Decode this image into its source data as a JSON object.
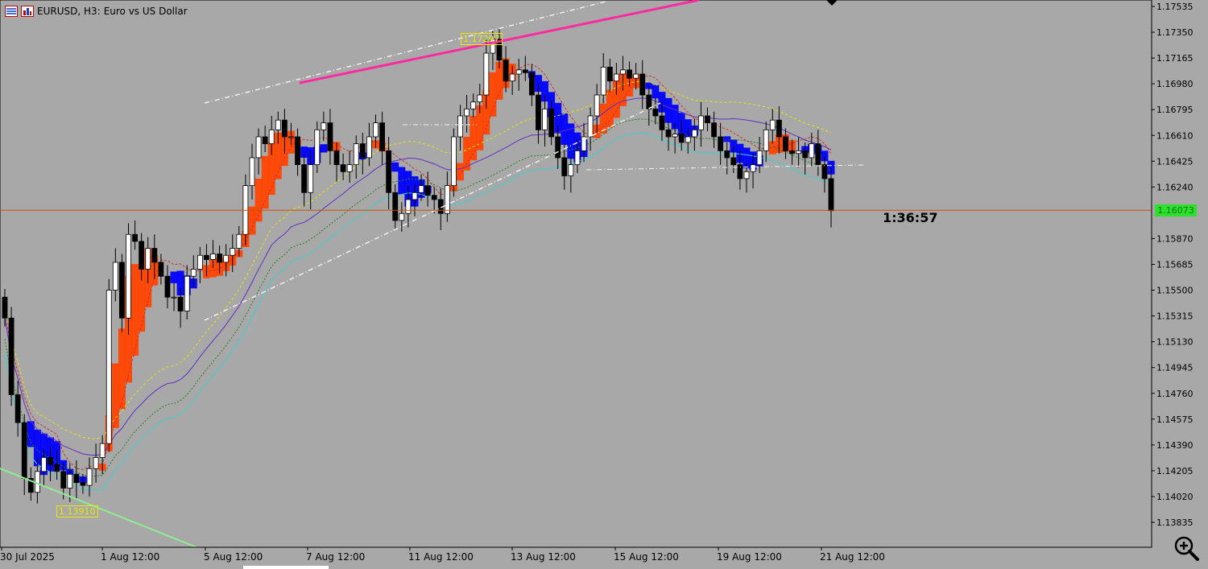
{
  "header": {
    "symbol": "EURUSD, H3:",
    "description": "Euro vs US Dollar"
  },
  "timer": "1:36:57",
  "current_price_label": "1.16073",
  "high_label": "1.17297",
  "low_label": "1.13910",
  "icons": [
    "grid-icon",
    "bar-chart-icon",
    "zoom-in-icon"
  ],
  "colors": {
    "background": "#a8a8a8",
    "bull_candle": "#ffffff",
    "bear_candle": "#000000",
    "cloud_bear": "#ff4500",
    "cloud_bull": "#0000ff",
    "price_line": "#d05000",
    "trend_magenta": "#ff2aa0",
    "trend_green": "#90ee90",
    "yellow": "#e8e800",
    "cyan": "#40d0d0"
  },
  "chart_data": {
    "type": "candlestick",
    "title": "",
    "ylim": [
      1.1374,
      1.1762
    ],
    "y_ticks": [
      1.17535,
      1.1735,
      1.17165,
      1.1698,
      1.16795,
      1.1661,
      1.16425,
      1.1624,
      1.1587,
      1.15685,
      1.155,
      1.15315,
      1.1513,
      1.14945,
      1.1476,
      1.14575,
      1.1439,
      1.14205,
      1.1402,
      1.13835
    ],
    "y_tick_labels": [
      "1.17535",
      "1.17350",
      "1.17165",
      "1.16980",
      "1.16795",
      "1.16610",
      "1.16425",
      "1.16240",
      "1.15870",
      "1.15685",
      "1.15500",
      "1.15315",
      "1.15130",
      "1.14945",
      "1.14760",
      "1.14575",
      "1.14390",
      "1.14205",
      "1.14020",
      "1.13835"
    ],
    "x_labels": [
      "30 Jul 2025",
      "1 Aug 12:00",
      "5 Aug 12:00",
      "7 Aug 12:00",
      "11 Aug 12:00",
      "13 Aug 12:00",
      "15 Aug 12:00",
      "19 Aug 12:00",
      "21 Aug 12:00"
    ],
    "current_price": 1.16073,
    "high": 1.17297,
    "low": 1.1391,
    "ohlc_close": [
      1.153,
      1.1475,
      1.1455,
      1.1415,
      1.1405,
      1.142,
      1.143,
      1.1425,
      1.142,
      1.1408,
      1.1418,
      1.1412,
      1.141,
      1.1422,
      1.143,
      1.144,
      1.155,
      1.157,
      1.153,
      1.159,
      1.1585,
      1.1565,
      1.158,
      1.157,
      1.156,
      1.1545,
      1.1545,
      1.1535,
      1.156,
      1.1565,
      1.1575,
      1.1572,
      1.1576,
      1.157,
      1.1575,
      1.158,
      1.159,
      1.1625,
      1.1645,
      1.166,
      1.1655,
      1.1665,
      1.1672,
      1.166,
      1.166,
      1.164,
      1.162,
      1.164,
      1.1665,
      1.167,
      1.165,
      1.164,
      1.1635,
      1.164,
      1.1655,
      1.1645,
      1.166,
      1.167,
      1.165,
      1.162,
      1.16,
      1.1605,
      1.1615,
      1.162,
      1.1625,
      1.1618,
      1.1615,
      1.1605,
      1.1625,
      1.166,
      1.1675,
      1.168,
      1.1685,
      1.169,
      1.172,
      1.173,
      1.1715,
      1.17,
      1.1705,
      1.1708,
      1.1706,
      1.169,
      1.1665,
      1.168,
      1.166,
      1.1645,
      1.1632,
      1.164,
      1.165,
      1.166,
      1.1675,
      1.169,
      1.171,
      1.17,
      1.1705,
      1.1708,
      1.1702,
      1.1705,
      1.169,
      1.168,
      1.1675,
      1.1665,
      1.166,
      1.1662,
      1.1656,
      1.166,
      1.1665,
      1.1675,
      1.167,
      1.166,
      1.165,
      1.1645,
      1.164,
      1.163,
      1.1635,
      1.164,
      1.165,
      1.1665,
      1.1672,
      1.166,
      1.165,
      1.1648,
      1.165,
      1.1645,
      1.1655,
      1.164,
      1.163,
      1.1607
    ]
  }
}
